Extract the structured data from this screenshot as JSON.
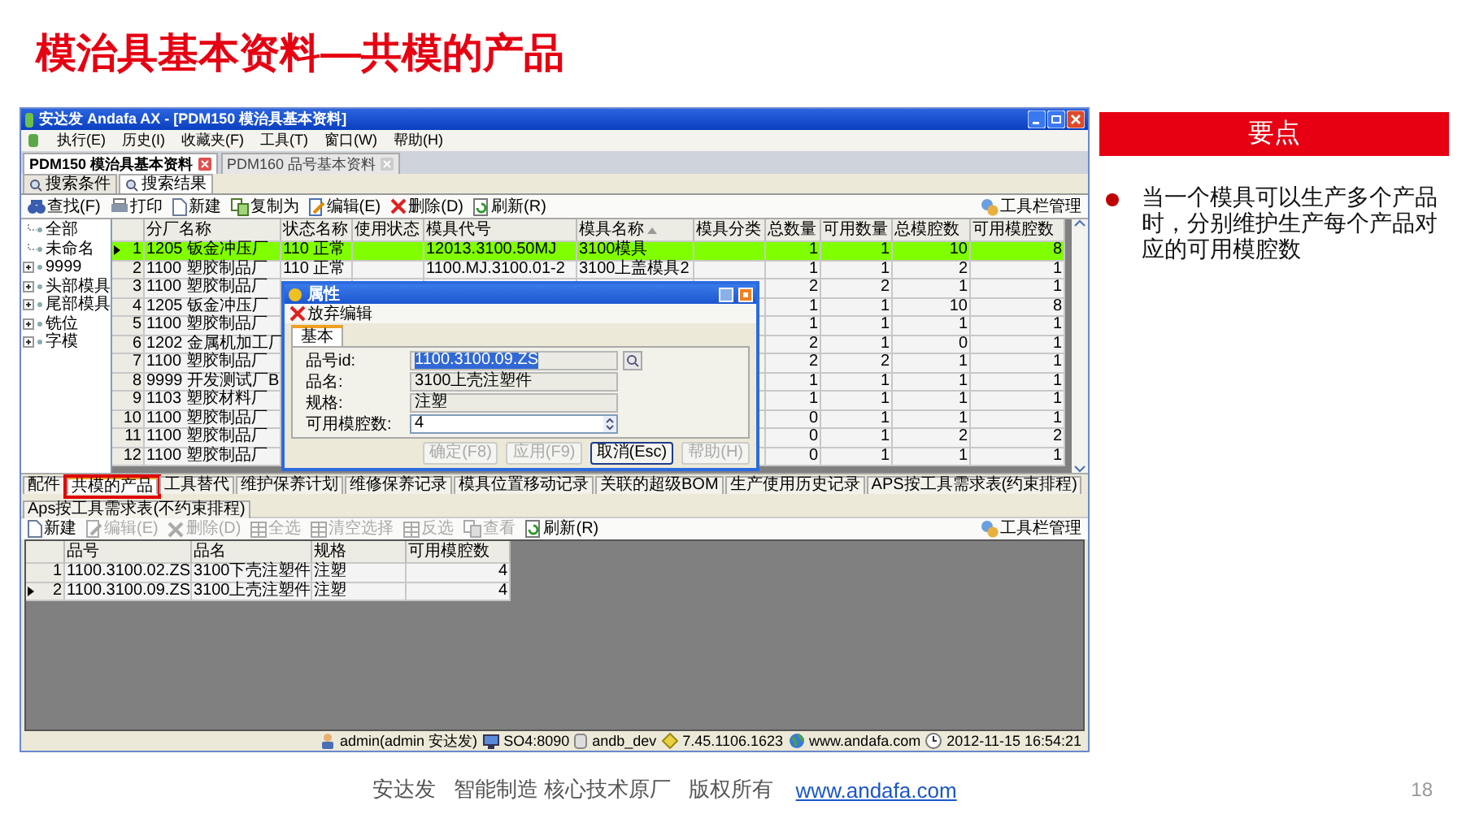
{
  "slide": {
    "title": "模治具基本资料—共模的产品",
    "footer_text": "安达发   智能制造 核心技术原厂   版权所有",
    "footer_link": "www.andafa.com",
    "page_number": "18"
  },
  "app": {
    "window_title": "安达发 Andafa AX - [PDM150 模治具基本资料]",
    "menu": [
      "执行(E)",
      "历史(I)",
      "收藏夹(F)",
      "工具(T)",
      "窗口(W)",
      "帮助(H)"
    ],
    "doc_tabs": [
      {
        "label": "PDM150 模治具基本资料",
        "selected": true
      },
      {
        "label": "PDM160 品号基本资料",
        "selected": false
      }
    ],
    "sub_tabs": [
      {
        "label": "搜索条件",
        "selected": false
      },
      {
        "label": "搜索结果",
        "selected": true
      }
    ],
    "toolbar": {
      "buttons": [
        {
          "label": "查找(F)",
          "disabled": false
        },
        {
          "label": "打印",
          "disabled": false
        },
        {
          "label": "新建",
          "disabled": false
        },
        {
          "label": "复制为",
          "disabled": false
        },
        {
          "label": "编辑(E)",
          "disabled": false
        },
        {
          "label": "删除(D)",
          "disabled": false
        },
        {
          "label": "刷新(R)",
          "disabled": false
        }
      ],
      "manage": "工具栏管理"
    },
    "tree": [
      {
        "label": "全部",
        "kind": "leaf"
      },
      {
        "label": "未命名",
        "kind": "leaf"
      },
      {
        "label": "9999",
        "kind": "folder",
        "expanded": false
      },
      {
        "label": "头部模具",
        "kind": "folder",
        "expanded": false
      },
      {
        "label": "尾部模具",
        "kind": "folder",
        "expanded": false
      },
      {
        "label": "铣位",
        "kind": "folder",
        "expanded": false
      },
      {
        "label": "字模",
        "kind": "folder",
        "expanded": false
      }
    ],
    "table": {
      "columns": [
        {
          "label": "分厂名称",
          "sorted": false
        },
        {
          "label": "状态名称",
          "sorted": false
        },
        {
          "label": "使用状态",
          "sorted": false
        },
        {
          "label": "模具代号",
          "sorted": false
        },
        {
          "label": "模具名称",
          "sorted": true
        },
        {
          "label": "模具分类",
          "sorted": false
        },
        {
          "label": "总数量",
          "sorted": false
        },
        {
          "label": "可用数量",
          "sorted": false
        },
        {
          "label": "总模腔数",
          "sorted": false
        },
        {
          "label": "可用模腔数",
          "sorted": false
        }
      ],
      "rows": [
        {
          "number": "1",
          "selected": true,
          "cells": [
            "1205 钣金冲压厂",
            "110 正常",
            null,
            "12013.3100.50MJ",
            "3100模具",
            null,
            "1",
            "1",
            "10",
            "8"
          ]
        },
        {
          "number": "2",
          "selected": false,
          "cells": [
            "1100 塑胶制品厂",
            "110 正常",
            null,
            "1100.MJ.3100.01-2",
            "3100上盖模具2",
            null,
            "1",
            "1",
            "2",
            "1"
          ]
        },
        {
          "number": "3",
          "selected": false,
          "cells": [
            "1100 塑胶制品厂",
            null,
            null,
            null,
            null,
            null,
            "2",
            "2",
            "1",
            "1"
          ]
        },
        {
          "number": "4",
          "selected": false,
          "cells": [
            "1205 钣金冲压厂",
            null,
            null,
            null,
            null,
            null,
            "1",
            "1",
            "10",
            "8"
          ]
        },
        {
          "number": "5",
          "selected": false,
          "cells": [
            "1100 塑胶制品厂",
            null,
            null,
            null,
            null,
            null,
            "1",
            "1",
            "1",
            "1"
          ]
        },
        {
          "number": "6",
          "selected": false,
          "cells": [
            "1202 金属机加工厂",
            null,
            null,
            null,
            null,
            null,
            "2",
            "1",
            "0",
            "1"
          ]
        },
        {
          "number": "7",
          "selected": false,
          "cells": [
            "1100 塑胶制品厂",
            null,
            null,
            null,
            null,
            null,
            "2",
            "2",
            "1",
            "1"
          ]
        },
        {
          "number": "8",
          "selected": false,
          "cells": [
            "9999 开发测试厂B",
            null,
            null,
            null,
            null,
            null,
            "1",
            "1",
            "1",
            "1"
          ]
        },
        {
          "number": "9",
          "selected": false,
          "cells": [
            "1103 塑胶材料厂",
            null,
            null,
            null,
            null,
            null,
            "1",
            "1",
            "1",
            "1"
          ]
        },
        {
          "number": "10",
          "selected": false,
          "cells": [
            "1100 塑胶制品厂",
            null,
            null,
            null,
            null,
            null,
            "0",
            "1",
            "1",
            "1"
          ]
        },
        {
          "number": "11",
          "selected": false,
          "cells": [
            "1100 塑胶制品厂",
            null,
            null,
            null,
            null,
            null,
            "0",
            "1",
            "2",
            "2"
          ]
        },
        {
          "number": "12",
          "selected": false,
          "cells": [
            "1100 塑胶制品厂",
            null,
            null,
            null,
            null,
            null,
            "0",
            "1",
            "1",
            "1"
          ]
        }
      ]
    },
    "dialog": {
      "title": "属性",
      "toolbar_button": "放弃编辑",
      "tab": "基本",
      "fields": [
        {
          "label": "品号id:",
          "value": "1100.3100.09.ZS",
          "kind": "lookup",
          "text_selected": true
        },
        {
          "label": "品名:",
          "value": "3100上壳注塑件",
          "kind": "readonly",
          "text_selected": false
        },
        {
          "label": "规格:",
          "value": "注塑",
          "kind": "readonly",
          "text_selected": false
        },
        {
          "label": "可用模腔数:",
          "value": "4",
          "kind": "spinner",
          "text_selected": false
        }
      ],
      "buttons": [
        {
          "label": "确定(F8)",
          "disabled": true
        },
        {
          "label": "应用(F9)",
          "disabled": true
        },
        {
          "label": "取消(Esc)",
          "disabled": false
        },
        {
          "label": "帮助(H)",
          "disabled": true
        }
      ]
    },
    "lower_tabs": [
      {
        "label": "配件",
        "selected": false,
        "highlighted": false
      },
      {
        "label": "共模的产品",
        "selected": true,
        "highlighted": true
      },
      {
        "label": "工具替代",
        "selected": false,
        "highlighted": false
      },
      {
        "label": "维护保养计划",
        "selected": false,
        "highlighted": false
      },
      {
        "label": "维修保养记录",
        "selected": false,
        "highlighted": false
      },
      {
        "label": "模具位置移动记录",
        "selected": false,
        "highlighted": false
      },
      {
        "label": "关联的超级BOM",
        "selected": false,
        "highlighted": false
      },
      {
        "label": "生产使用历史记录",
        "selected": false,
        "highlighted": false
      },
      {
        "label": "APS按工具需求表(约束排程)",
        "selected": false,
        "highlighted": false
      },
      {
        "label": "Aps按工具需求表(不约束排程)",
        "selected": false,
        "highlighted": false
      }
    ],
    "lower_toolbar": {
      "buttons": [
        {
          "label": "新建",
          "disabled": false
        },
        {
          "label": "编辑(E)",
          "disabled": true
        },
        {
          "label": "删除(D)",
          "disabled": true
        },
        {
          "label": "全选",
          "disabled": true
        },
        {
          "label": "清空选择",
          "disabled": true
        },
        {
          "label": "反选",
          "disabled": true
        },
        {
          "label": "查看",
          "disabled": true
        },
        {
          "label": "刷新(R)",
          "disabled": false
        }
      ],
      "manage": "工具栏管理"
    },
    "lower_table": {
      "columns": [
        "品号",
        "品名",
        "规格",
        "可用模腔数"
      ],
      "rows": [
        {
          "number": "1",
          "selected": false,
          "cells": [
            "1100.3100.02.ZS",
            "3100下壳注塑件",
            "注塑",
            "4"
          ]
        },
        {
          "number": "2",
          "selected": true,
          "cells": [
            "1100.3100.09.ZS",
            "3100上壳注塑件",
            "注塑",
            "4"
          ]
        }
      ]
    },
    "status_bar": [
      "admin(admin 安达发)",
      "SO4:8090",
      "andb_dev",
      "7.45.1106.1623",
      "www.andafa.com",
      "2012-11-15 16:54:21"
    ]
  },
  "notes": {
    "header": "要点",
    "bullets": [
      "当一个模具可以生产多个产品时，分别维护生产每个产品对应的可用模腔数"
    ]
  }
}
